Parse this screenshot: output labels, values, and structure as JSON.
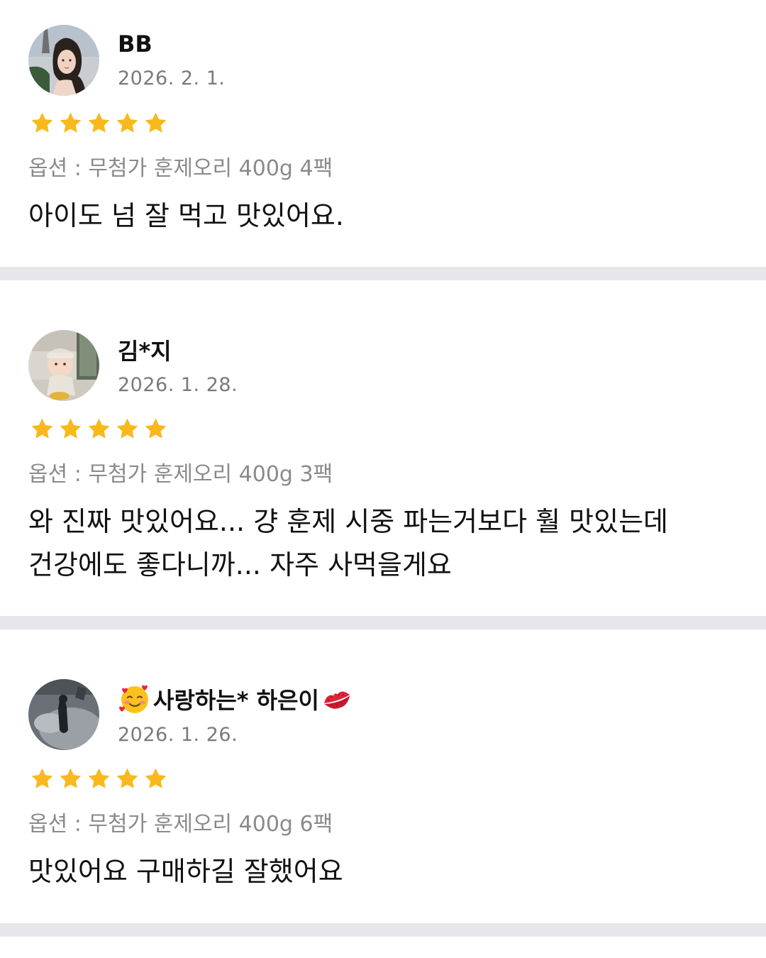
{
  "reviews": [
    {
      "avatar_icon": "woman-portrait-avatar",
      "name": "BB",
      "date": "2026. 2. 1.",
      "rating": 5,
      "option": "옵션 : 무첨가 훈제오리 400g 4팩",
      "text": "아이도 넘 잘 먹고 맛있어요."
    },
    {
      "avatar_icon": "baby-portrait-avatar",
      "name": "김*지",
      "date": "2026. 1. 28.",
      "rating": 5,
      "option": "옵션 : 무첨가 훈제오리 400g 3팩",
      "text_line1": "와 진짜 맛있어요... 걍 훈제 시중 파는거보다 훨 맛있는데",
      "text_line2": "건강에도 좋다니까... 자주 사먹을게요"
    },
    {
      "avatar_icon": "penguin-photo-avatar",
      "name_prefix_icon": "smiling-face-with-hearts-emoji",
      "name": "사랑하는* 하은이",
      "name_suffix_icon": "kiss-mark-emoji",
      "date": "2026. 1. 26.",
      "rating": 5,
      "option": "옵션 : 무첨가 훈제오리 400g 6팩",
      "text": "맛있어요 구매하길 잘했어요"
    }
  ],
  "colors": {
    "star": "#f9b81c",
    "divider": "#e6e7ea",
    "date": "#7a7a7a",
    "option": "#8a8a8a"
  }
}
